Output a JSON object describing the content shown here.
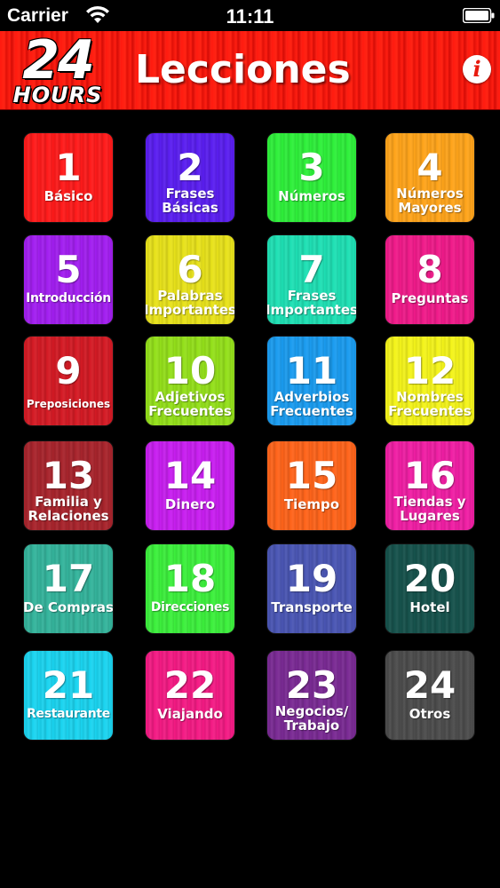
{
  "status_bar": {
    "carrier": "Carrier",
    "time": "11:11",
    "wifi_icon": "wifi-icon",
    "battery_icon": "battery-icon"
  },
  "header": {
    "logo_number": "24",
    "logo_word": "HOURS",
    "title": "Lecciones",
    "info_icon": "i",
    "accent_color": "#ff1a0f"
  },
  "lessons": [
    {
      "number": "1",
      "label": "Básico",
      "color": "#ff1a1a"
    },
    {
      "number": "2",
      "label": "Frases\nBásicas",
      "color": "#5a1ef0"
    },
    {
      "number": "3",
      "label": "Números",
      "color": "#2ef03a"
    },
    {
      "number": "4",
      "label": "Números\nMayores",
      "color": "#ffa41a"
    },
    {
      "number": "5",
      "label": "Introducción",
      "color": "#a21ef0"
    },
    {
      "number": "6",
      "label": "Palabras\nImportantes",
      "color": "#e8e21a"
    },
    {
      "number": "7",
      "label": "Frases\nImportantes",
      "color": "#1ee0b4"
    },
    {
      "number": "8",
      "label": "Preguntas",
      "color": "#f01a8a"
    },
    {
      "number": "9",
      "label": "Preposiciones",
      "color": "#d41a24"
    },
    {
      "number": "10",
      "label": "Adjetivos\nFrecuentes",
      "color": "#94e01a"
    },
    {
      "number": "11",
      "label": "Adverbios\nFrecuentes",
      "color": "#1a9cf0"
    },
    {
      "number": "12",
      "label": "Nombres\nFrecuentes",
      "color": "#f4f41a"
    },
    {
      "number": "13",
      "label": "Familia y\nRelaciones",
      "color": "#a8242c"
    },
    {
      "number": "14",
      "label": "Dinero",
      "color": "#c81ef0"
    },
    {
      "number": "15",
      "label": "Tiempo",
      "color": "#ff641a"
    },
    {
      "number": "16",
      "label": "Tiendas y\nLugares",
      "color": "#f01ea4"
    },
    {
      "number": "17",
      "label": "De Compras",
      "color": "#34b49c"
    },
    {
      "number": "18",
      "label": "Direcciones",
      "color": "#3cf03c"
    },
    {
      "number": "19",
      "label": "Transporte",
      "color": "#4a56b4"
    },
    {
      "number": "20",
      "label": "Hotel",
      "color": "#16524c"
    },
    {
      "number": "21",
      "label": "Restaurante",
      "color": "#1ad4f0"
    },
    {
      "number": "22",
      "label": "Viajando",
      "color": "#f41a84"
    },
    {
      "number": "23",
      "label": "Negocios/\nTrabajo",
      "color": "#7a2a94"
    },
    {
      "number": "24",
      "label": "Otros",
      "color": "#4c4c4c"
    }
  ]
}
